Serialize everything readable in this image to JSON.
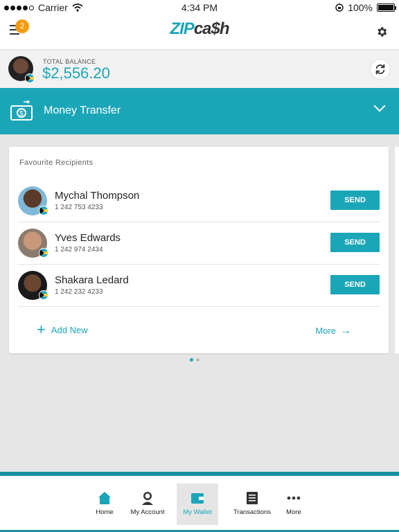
{
  "status": {
    "carrier": "Carrier",
    "time": "4:34 PM",
    "battery": "100%"
  },
  "header": {
    "badge_count": "2",
    "logo_zip": "ZIP",
    "logo_cash": "ca$h"
  },
  "balance": {
    "label": "TOTAL BALANCE",
    "amount": "$2,556.20"
  },
  "transfer": {
    "title": "Money Transfer"
  },
  "favourites": {
    "title": "Favourite Recipients",
    "send_label": "SEND",
    "recipients": [
      {
        "name": "Mychal Thompson",
        "phone": "1 242 753 4233"
      },
      {
        "name": "Yves Edwards",
        "phone": "1 242 974 2434"
      },
      {
        "name": "Shakara Ledard",
        "phone": "1 242 232 4233"
      }
    ],
    "add_new": "Add New",
    "more": "More"
  },
  "tabs": [
    {
      "label": "Home",
      "icon": "home-icon"
    },
    {
      "label": "My Account",
      "icon": "account-icon"
    },
    {
      "label": "My Wallet",
      "icon": "wallet-icon"
    },
    {
      "label": "Transactions",
      "icon": "transactions-icon"
    },
    {
      "label": "More",
      "icon": "more-icon"
    }
  ],
  "colors": {
    "accent": "#1ba6b8",
    "badge": "#f39c12"
  }
}
